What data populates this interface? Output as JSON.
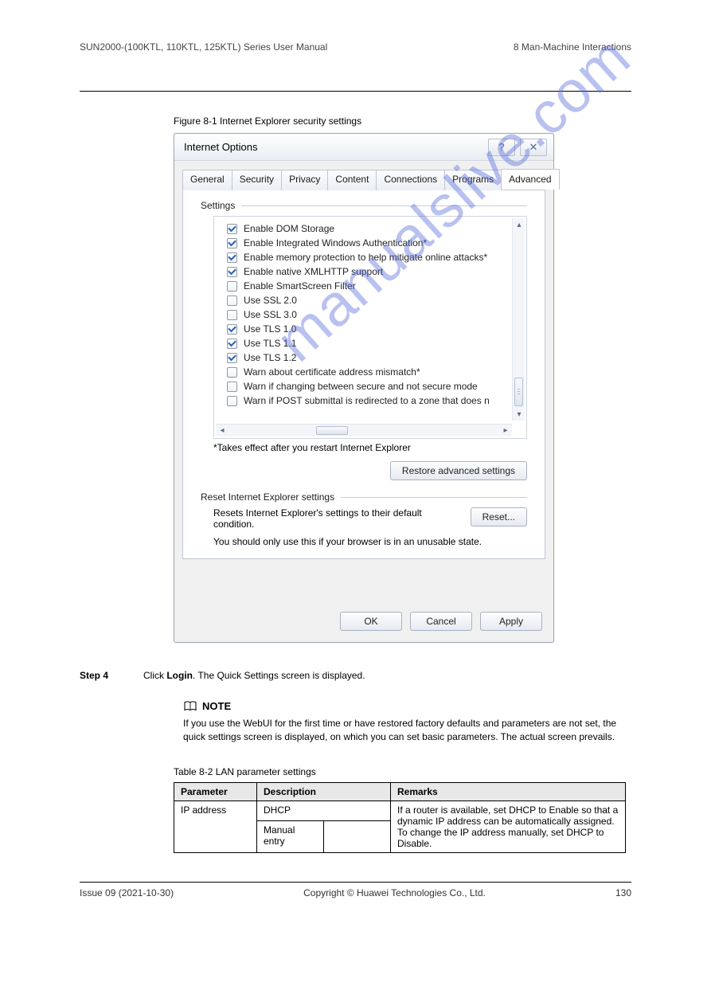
{
  "header": {
    "left": "SUN2000-(100KTL, 110KTL, 125KTL) Series\nUser Manual",
    "right": "8 Man-Machine Interactions"
  },
  "figure_caption": "Figure 8-1 Internet Explorer security settings",
  "dialog": {
    "title": "Internet Options",
    "help_icon": "?",
    "close_icon": "✕",
    "tabs": [
      "General",
      "Security",
      "Privacy",
      "Content",
      "Connections",
      "Programs",
      "Advanced"
    ],
    "active_tab_index": 6,
    "group_settings_label": "Settings",
    "settings": [
      {
        "label": "Enable DOM Storage",
        "checked": true
      },
      {
        "label": "Enable Integrated Windows Authentication*",
        "checked": true
      },
      {
        "label": "Enable memory protection to help mitigate online attacks*",
        "checked": true
      },
      {
        "label": "Enable native XMLHTTP support",
        "checked": true
      },
      {
        "label": "Enable SmartScreen Filter",
        "checked": false
      },
      {
        "label": "Use SSL 2.0",
        "checked": false
      },
      {
        "label": "Use SSL 3.0",
        "checked": false
      },
      {
        "label": "Use TLS 1.0",
        "checked": true
      },
      {
        "label": "Use TLS 1.1",
        "checked": true
      },
      {
        "label": "Use TLS 1.2",
        "checked": true
      },
      {
        "label": "Warn about certificate address mismatch*",
        "checked": false
      },
      {
        "label": "Warn if changing between secure and not secure mode",
        "checked": false
      },
      {
        "label": "Warn if POST submittal is redirected to a zone that does n",
        "checked": false
      }
    ],
    "restart_note": "*Takes effect after you restart Internet Explorer",
    "restore_button": "Restore advanced settings",
    "group_reset_label": "Reset Internet Explorer settings",
    "reset_text": "Resets Internet Explorer's settings to their default condition.",
    "reset_button": "Reset...",
    "advice": "You should only use this if your browser is in an unusable state.",
    "ok": "OK",
    "cancel": "Cancel",
    "apply": "Apply"
  },
  "watermark": "manualslive.com",
  "step": {
    "num": "Step 4",
    "text_a": "Click ",
    "login": "Login",
    "text_b": ". The Quick Settings screen is displayed."
  },
  "note": {
    "heading": "NOTE",
    "body": "If you use the WebUI for the first time or have restored factory defaults and parameters are not set, the quick settings screen is displayed, on which you can set basic parameters. The actual screen prevails."
  },
  "table_caption": "Table 8-2 LAN parameter settings",
  "table": {
    "headers": [
      "Parameter",
      "Description",
      "Remarks"
    ],
    "rows": [
      {
        "param": "IP address",
        "desc_a": "DHCP",
        "desc_b": "Manual entry",
        "remarks": "If a router is available, set DHCP to Enable so that a dynamic IP address can be automatically assigned. To change the IP address manually, set DHCP to Disable."
      }
    ]
  },
  "footer": {
    "left": "Issue 09 (2021-10-30)",
    "mid": "Copyright © Huawei Technologies Co., Ltd.",
    "right": "130"
  }
}
